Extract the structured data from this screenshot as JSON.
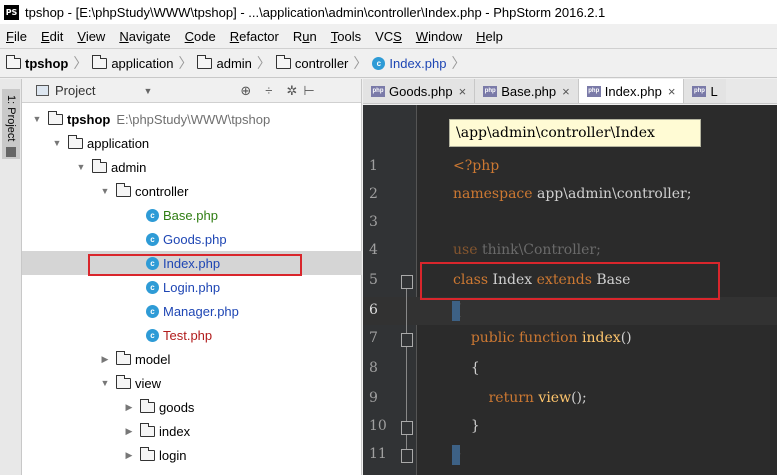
{
  "window": {
    "app_icon": "PS",
    "title": "tpshop - [E:\\phpStudy\\WWW\\tpshop] - ...\\application\\admin\\controller\\Index.php - PhpStorm 2016.2.1"
  },
  "menu": [
    {
      "u": "F",
      "rest": "ile"
    },
    {
      "u": "E",
      "rest": "dit"
    },
    {
      "u": "V",
      "rest": "iew"
    },
    {
      "u": "N",
      "rest": "avigate"
    },
    {
      "u": "C",
      "rest": "ode"
    },
    {
      "u": "R",
      "rest": "efactor"
    },
    {
      "pre": "R",
      "u": "u",
      "rest": "n"
    },
    {
      "u": "T",
      "rest": "ools"
    },
    {
      "pre": "VC",
      "u": "S",
      "rest": ""
    },
    {
      "u": "W",
      "rest": "indow"
    },
    {
      "u": "H",
      "rest": "elp"
    }
  ],
  "breadcrumbs": [
    "tpshop",
    "application",
    "admin",
    "controller",
    "Index.php"
  ],
  "side_tool": {
    "label": "1: Project"
  },
  "project": {
    "header": "Project",
    "tree": {
      "root": "tpshop",
      "root_path": "E:\\phpStudy\\WWW\\tpshop",
      "application": "application",
      "admin": "admin",
      "controller": "controller",
      "files": [
        "Base.php",
        "Goods.php",
        "Index.php",
        "Login.php",
        "Manager.php",
        "Test.php"
      ],
      "model": "model",
      "view": "view",
      "goods": "goods",
      "index": "index",
      "login": "login"
    }
  },
  "tabs": [
    {
      "label": "Goods.php",
      "close": "×"
    },
    {
      "label": "Base.php",
      "close": "×"
    },
    {
      "label": "Index.php",
      "close": "×"
    },
    {
      "label": "L",
      "close": ""
    }
  ],
  "editor": {
    "popup": "\\app\\admin\\controller\\Index",
    "line_numbers": [
      "1",
      "2",
      "3",
      "4",
      "5",
      "6",
      "7",
      "8",
      "9",
      "10",
      "11"
    ],
    "code": {
      "l1": "<?php",
      "l2_kw": "namespace",
      "l2_rest": " app\\admin\\controller;",
      "l4_kw": "use",
      "l4_rest": " think\\Controller;",
      "l5_kw1": "class",
      "l5_name": " Index ",
      "l5_kw2": "extends",
      "l5_base": " Base",
      "l6": "{",
      "l7_kw": "public function",
      "l7_fn": " index",
      "l7_rest": "()",
      "l8": "{",
      "l9_kw": "return",
      "l9_fn": " view",
      "l9_rest": "();",
      "l10": "}",
      "l11": "}"
    }
  }
}
